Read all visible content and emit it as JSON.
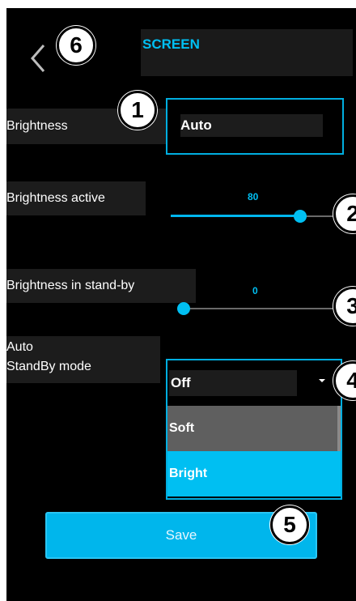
{
  "header": {
    "title": "SCREEN",
    "back_icon": "chevron-left-icon"
  },
  "callouts": [
    "1",
    "2",
    "3",
    "4",
    "5",
    "6"
  ],
  "brightness": {
    "label": "Brightness",
    "value": "Auto"
  },
  "brightness_active": {
    "label": "Brightness active",
    "value": "80",
    "fraction": 0.8
  },
  "brightness_standby": {
    "label": "Brightness in stand-by",
    "value": "0",
    "fraction": 0
  },
  "auto_standby": {
    "label_line1": "Auto",
    "label_line2": "StandBy mode",
    "value": "Off",
    "options": [
      "Soft",
      "Bright"
    ]
  },
  "save_label": "Save",
  "colors": {
    "accent": "#00bff2",
    "background": "#000000",
    "label_bg": "#1c1c1c"
  }
}
